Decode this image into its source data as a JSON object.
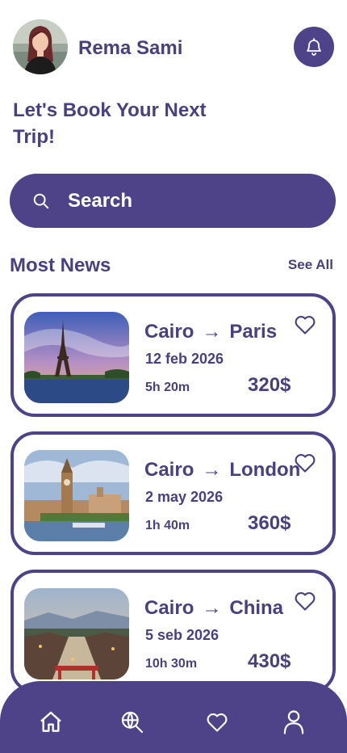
{
  "colors": {
    "primary": "#4e4289",
    "text": "#4a3f7f",
    "background": "#ffffff"
  },
  "user": {
    "name": "Rema Sami",
    "avatar_icon": "user-avatar-photo"
  },
  "header": {
    "bell_icon": "bell-icon"
  },
  "headline": "Let's Book Your Next Trip!",
  "search": {
    "label": "Search",
    "icon": "search-icon"
  },
  "news": {
    "title": "Most News",
    "see_all": "See All",
    "trips": [
      {
        "from": "Cairo",
        "to": "Paris",
        "date": "12 feb 2026",
        "duration": "5h 20m",
        "price": "320$",
        "image": "eiffel-tower-photo"
      },
      {
        "from": "Cairo",
        "to": "London",
        "date": "2 may 2026",
        "duration": "1h 40m",
        "price": "360$",
        "image": "big-ben-photo"
      },
      {
        "from": "Cairo",
        "to": "China",
        "date": "5 seb 2026",
        "duration": "10h 30m",
        "price": "430$",
        "image": "chinese-town-photo"
      }
    ]
  },
  "nav": {
    "items": [
      "home-icon",
      "globe-search-icon",
      "heart-icon",
      "profile-icon"
    ]
  }
}
